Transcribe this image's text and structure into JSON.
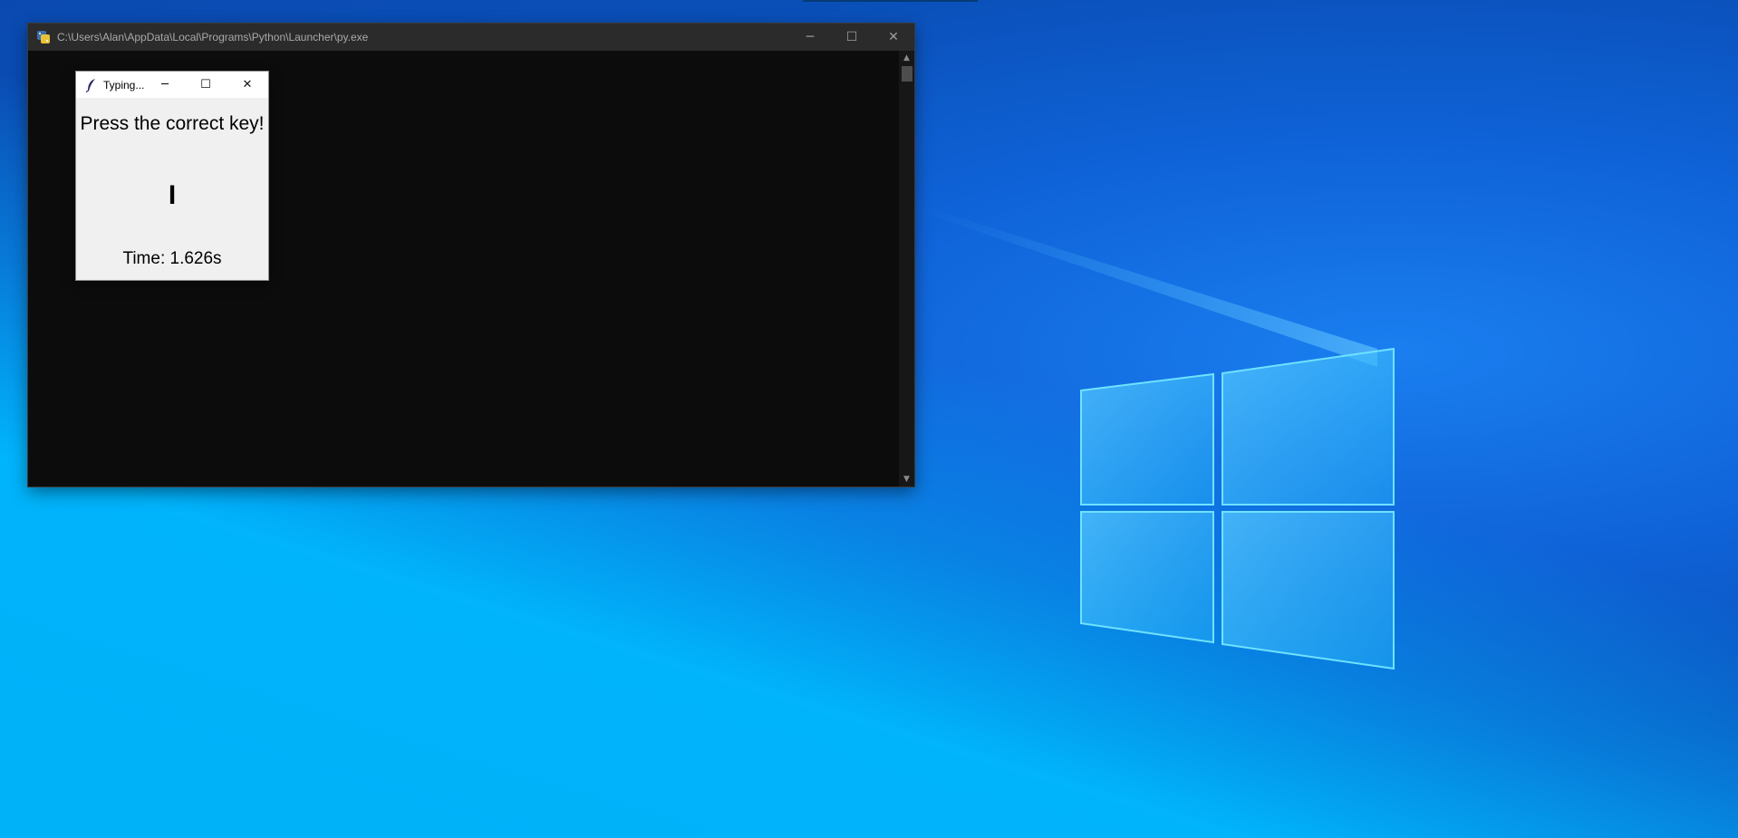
{
  "console_window": {
    "title": "C:\\Users\\Alan\\AppData\\Local\\Programs\\Python\\Launcher\\py.exe",
    "icon": "python-launcher-icon",
    "controls": {
      "minimize": "─",
      "maximize": "☐",
      "close": "✕"
    },
    "scrollbar": {
      "up": "▲",
      "down": "▼"
    }
  },
  "tk_window": {
    "title": "Typing...",
    "icon": "tk-feather-icon",
    "controls": {
      "minimize": "─",
      "maximize": "☐",
      "close": "✕"
    },
    "prompt": "Press the correct key!",
    "key": "I",
    "timer": "Time: 1.626s"
  },
  "colors": {
    "desktop_blue": "#0a4fb8",
    "desktop_cyan": "#00b2f7",
    "console_bg": "#0c0c0c",
    "console_titlebar": "#2b2b2b",
    "tk_bg": "#f0f0f0"
  }
}
